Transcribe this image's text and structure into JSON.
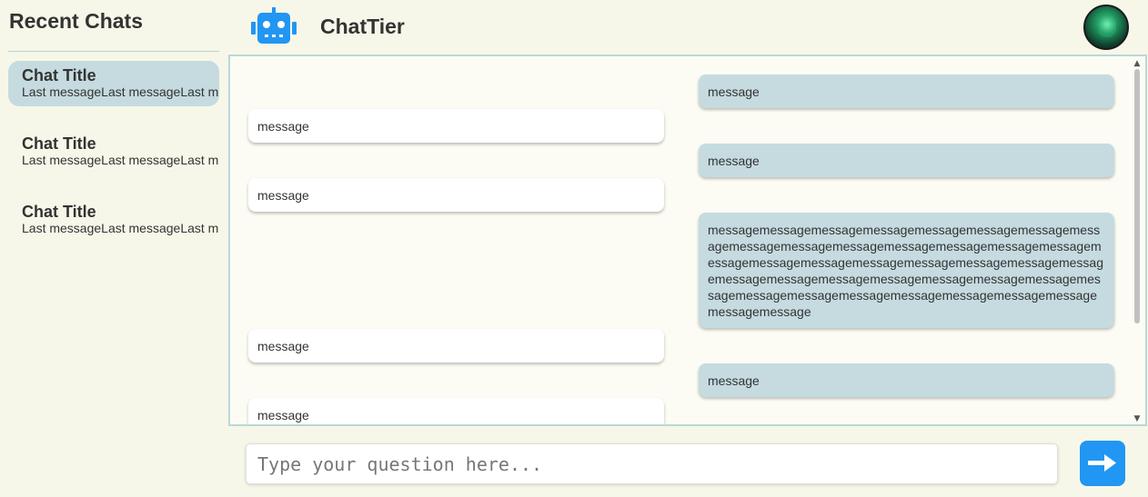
{
  "sidebar": {
    "title": "Recent Chats",
    "items": [
      {
        "title": "Chat Title",
        "last": "Last messageLast messageLast message"
      },
      {
        "title": "Chat Title",
        "last": "Last messageLast messageLast message"
      },
      {
        "title": "Chat Title",
        "last": "Last messageLast messageLast message"
      }
    ]
  },
  "header": {
    "app_title": "ChatTier",
    "logo_icon": "robot-icon",
    "avatar_icon": "user-avatar"
  },
  "messages": [
    {
      "role": "user",
      "text": "message"
    },
    {
      "role": "bot",
      "text": "message"
    },
    {
      "role": "user",
      "text": "message"
    },
    {
      "role": "bot",
      "text": "message"
    },
    {
      "role": "user",
      "text": "messagemessagemessagemessagemessagemessagemessagemessagemessagemessagemessagemessagemessagemessagemessagemessagemessagemessagemessagemessagemessagemessagemessagemessagemessagemessagemessagemessagemessagemessagemessagemessagemessagemessagemessagemessagemessagemessagemessagemessage"
    },
    {
      "role": "bot",
      "text": "message"
    },
    {
      "role": "user",
      "text": "message"
    },
    {
      "role": "bot",
      "text": "message"
    }
  ],
  "input": {
    "placeholder": "Type your question here...",
    "value": ""
  },
  "send_button": {
    "icon": "arrow-right-icon"
  },
  "colors": {
    "background": "#f7f7e9",
    "active_chat": "#c5dbe0",
    "user_bubble": "#c5dbe0",
    "bot_bubble": "#ffffff",
    "accent": "#2196f3"
  }
}
